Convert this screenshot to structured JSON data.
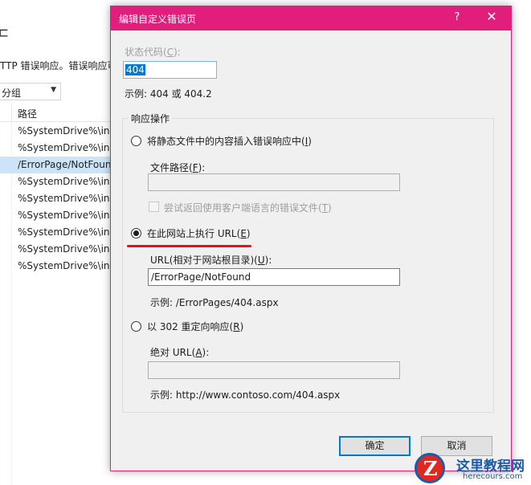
{
  "background_window": {
    "title_partial": "ㄷ",
    "description": "TTP 错误响应。错误响应可",
    "group_by": {
      "value": "分组"
    },
    "list": {
      "column_header": "路径",
      "rows": [
        {
          "path": "%SystemDrive%\\inetpub\\custerr",
          "selected": false
        },
        {
          "path": "%SystemDrive%\\inetpub\\custerr",
          "selected": false
        },
        {
          "path": "/ErrorPage/NotFound",
          "selected": true
        },
        {
          "path": "%SystemDrive%\\inetpub\\custerr",
          "selected": false
        },
        {
          "path": "%SystemDrive%\\inetpub\\custerr",
          "selected": false
        },
        {
          "path": "%SystemDrive%\\inetpub\\custerr",
          "selected": false
        },
        {
          "path": "%SystemDrive%\\inetpub\\custerr",
          "selected": false
        },
        {
          "path": "%SystemDrive%\\inetpub\\custerr",
          "selected": false
        },
        {
          "path": "%SystemDrive%\\inetpub\\custerr",
          "selected": false
        }
      ]
    }
  },
  "dialog": {
    "title": "编辑自定义错误页",
    "help_glyph": "?",
    "close_glyph": "✕",
    "status_code": {
      "label_main": "状态代码(",
      "label_key": "C",
      "label_tail": "):",
      "value": "404",
      "example": "示例: 404 或 404.2"
    },
    "group_title": "响应操作",
    "option_static": {
      "label_main": "将静态文件中的内容插入错误响应中(",
      "label_key": "I",
      "label_tail": ")",
      "selected": false,
      "file_path_label_main": "文件路径(",
      "file_path_label_key": "F",
      "file_path_label_tail": "):",
      "file_path_value": "",
      "localized_label_main": "尝试返回使用客户端语言的错误文件(",
      "localized_label_key": "T",
      "localized_label_tail": ")",
      "localized_checked": false
    },
    "option_execute": {
      "label_main": "在此网站上执行 URL(",
      "label_key": "E",
      "label_tail": ")",
      "selected": true,
      "url_label_main": "URL(相对于网站根目录)(",
      "url_label_key": "U",
      "url_label_tail": "):",
      "url_value": "/ErrorPage/NotFound",
      "url_example": "示例: /ErrorPages/404.aspx"
    },
    "option_redirect": {
      "label_main": "以 302 重定向响应(",
      "label_key": "R",
      "label_tail": ")",
      "selected": false,
      "abs_label_main": "绝对 URL(",
      "abs_label_key": "A",
      "abs_label_tail": "):",
      "abs_value": "",
      "abs_example": "示例: http://www.contoso.com/404.aspx"
    },
    "ok_label": "确定",
    "cancel_label": "取消"
  },
  "watermark": {
    "name": "这里教程网",
    "domain": "herecours.com"
  },
  "colors": {
    "titlebar": "#e21e7c",
    "selection": "#0078d7",
    "annotation_underline": "#e0141e",
    "list_selected": "#cce4f7"
  }
}
